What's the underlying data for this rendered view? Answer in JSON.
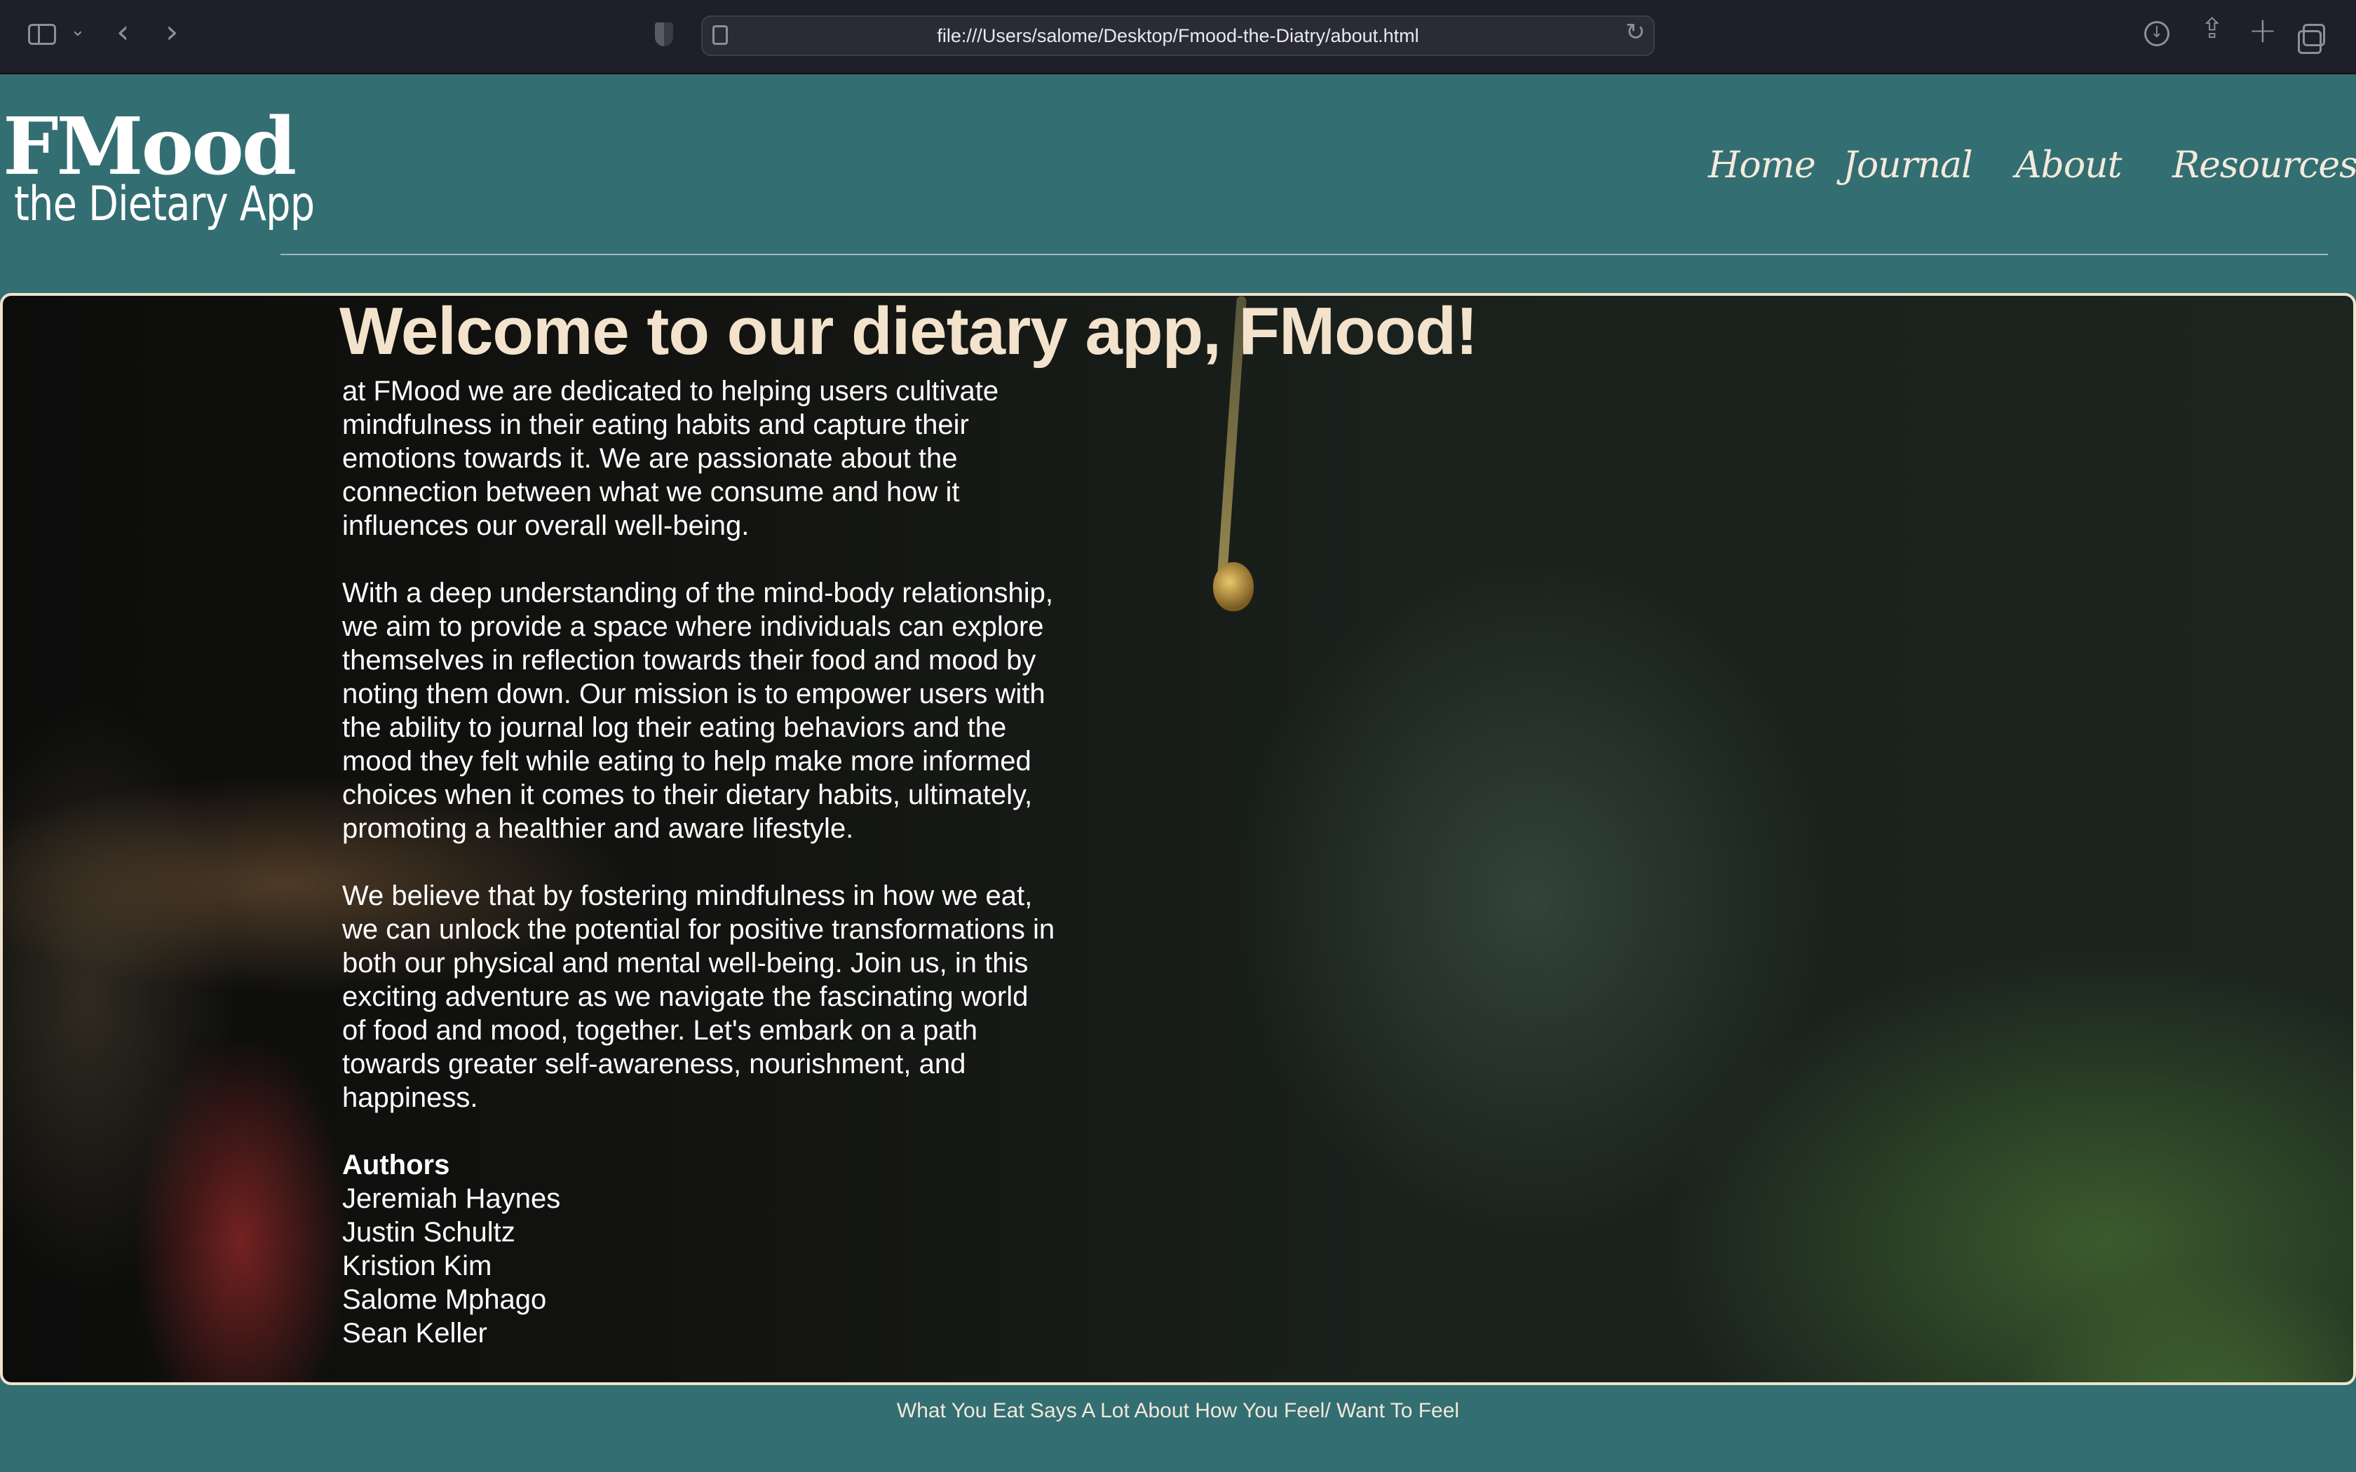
{
  "browser": {
    "url": "file:///Users/salome/Desktop/Fmood-the-Diatry/about.html",
    "icons": [
      "sidebar-icon",
      "chevron-down-icon",
      "back-icon",
      "forward-icon",
      "shield-icon",
      "page-icon",
      "reload-icon",
      "download-icon",
      "share-icon",
      "new-tab-icon",
      "tabs-icon"
    ]
  },
  "brand": {
    "name": "FMood",
    "tagline": "the Dietary App"
  },
  "nav": {
    "home": "Home",
    "journal": "Journal",
    "about": "About",
    "resources": "Resources"
  },
  "hero": {
    "title": "Welcome to our dietary app, FMood!",
    "paragraphs": [
      "at FMood we are dedicated to helping users cultivate mindfulness in their eating habits and capture their emotions towards it. We are passionate about the connection between what we consume and how it influences our overall well-being.",
      "With a deep understanding of the mind-body relationship, we aim to provide a space where individuals can explore themselves in reflection towards their food and mood by noting them down. Our mission is to empower users with the ability to journal log their eating behaviors and the mood they felt while eating to help make more informed choices when it comes to their dietary habits, ultimately, promoting a healthier and aware lifestyle.",
      "We believe that by fostering mindfulness in how we eat, we can unlock the potential for positive transformations in both our physical and mental well-being. Join us, in this exciting adventure as we navigate the fascinating world of food and mood, together. Let's embark on a path towards greater self-awareness, nourishment, and happiness."
    ],
    "authors_heading": "Authors",
    "authors": [
      "Jeremiah Haynes",
      "Justin Schultz",
      "Kristion Kim",
      "Salome Mphago",
      "Sean Keller"
    ]
  },
  "footer": {
    "text": "What You Eat Says A Lot About How You Feel/ Want To Feel"
  },
  "colors": {
    "background": "#336e72",
    "heading": "#f4e3cc",
    "border": "#efe3cc"
  }
}
